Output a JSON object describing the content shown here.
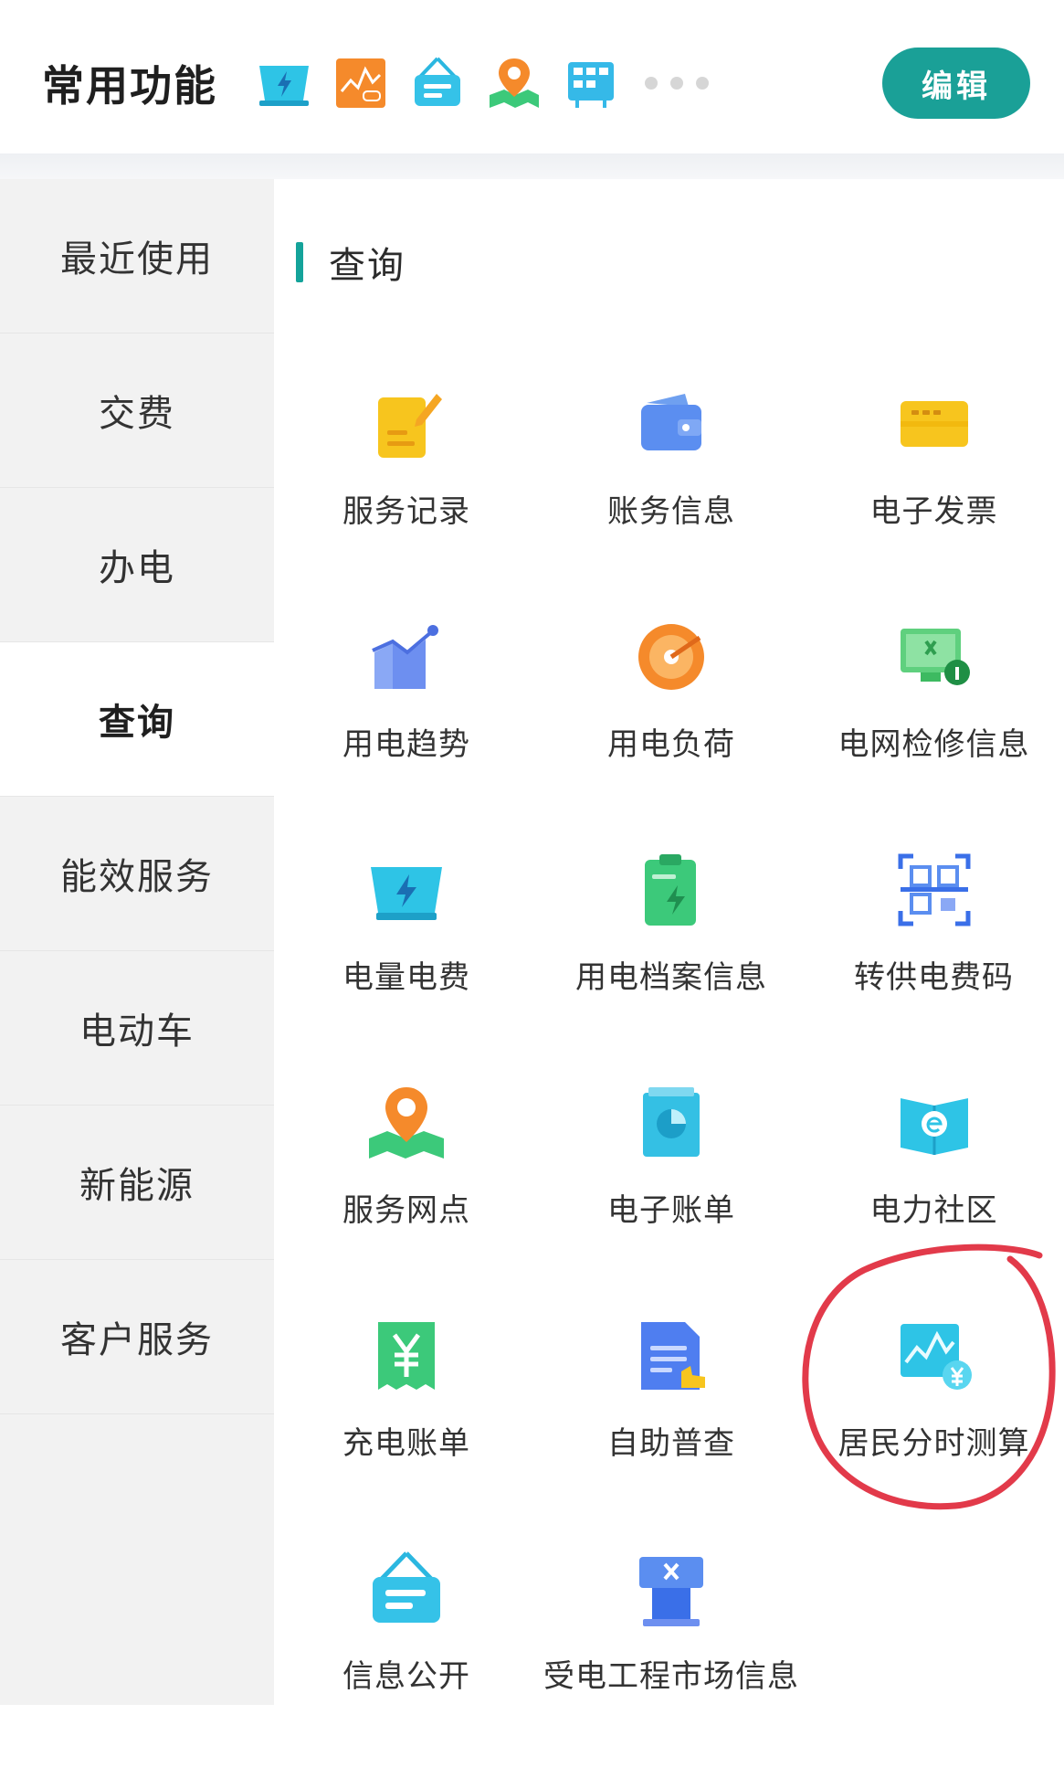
{
  "header": {
    "title": "常用功能",
    "edit_label": "编辑",
    "quick_icons": [
      "lightning-tray-icon",
      "chart-orange-icon",
      "sign-board-icon",
      "map-pin-icon",
      "battery-grid-icon"
    ]
  },
  "sidebar": {
    "items": [
      {
        "label": "最近使用"
      },
      {
        "label": "交费"
      },
      {
        "label": "办电"
      },
      {
        "label": "查询"
      },
      {
        "label": "能效服务"
      },
      {
        "label": "电动车"
      },
      {
        "label": "新能源"
      },
      {
        "label": "客户服务"
      }
    ],
    "active_index": 3
  },
  "main": {
    "section_title": "查询",
    "items": [
      {
        "label": "服务记录",
        "icon": "notepad-icon"
      },
      {
        "label": "账务信息",
        "icon": "wallet-icon"
      },
      {
        "label": "电子发票",
        "icon": "invoice-icon"
      },
      {
        "label": "用电趋势",
        "icon": "trend-chart-icon"
      },
      {
        "label": "用电负荷",
        "icon": "gauge-icon"
      },
      {
        "label": "电网检修信息",
        "icon": "monitor-repair-icon"
      },
      {
        "label": "电量电费",
        "icon": "lightning-tray-icon"
      },
      {
        "label": "用电档案信息",
        "icon": "clipboard-lightning-icon"
      },
      {
        "label": "转供电费码",
        "icon": "qr-code-icon"
      },
      {
        "label": "服务网点",
        "icon": "map-pin-icon"
      },
      {
        "label": "电子账单",
        "icon": "bill-pie-icon"
      },
      {
        "label": "电力社区",
        "icon": "community-book-icon"
      },
      {
        "label": "充电账单",
        "icon": "yuan-receipt-icon"
      },
      {
        "label": "自助普查",
        "icon": "document-hand-icon"
      },
      {
        "label": "居民分时测算",
        "icon": "chart-yuan-icon"
      },
      {
        "label": "信息公开",
        "icon": "sign-board-icon"
      },
      {
        "label": "受电工程市场信息",
        "icon": "kiosk-tools-icon"
      }
    ]
  },
  "colors": {
    "accent": "#1aa097",
    "section_bar": "#14a39a",
    "annotation": "#e23a4a"
  }
}
